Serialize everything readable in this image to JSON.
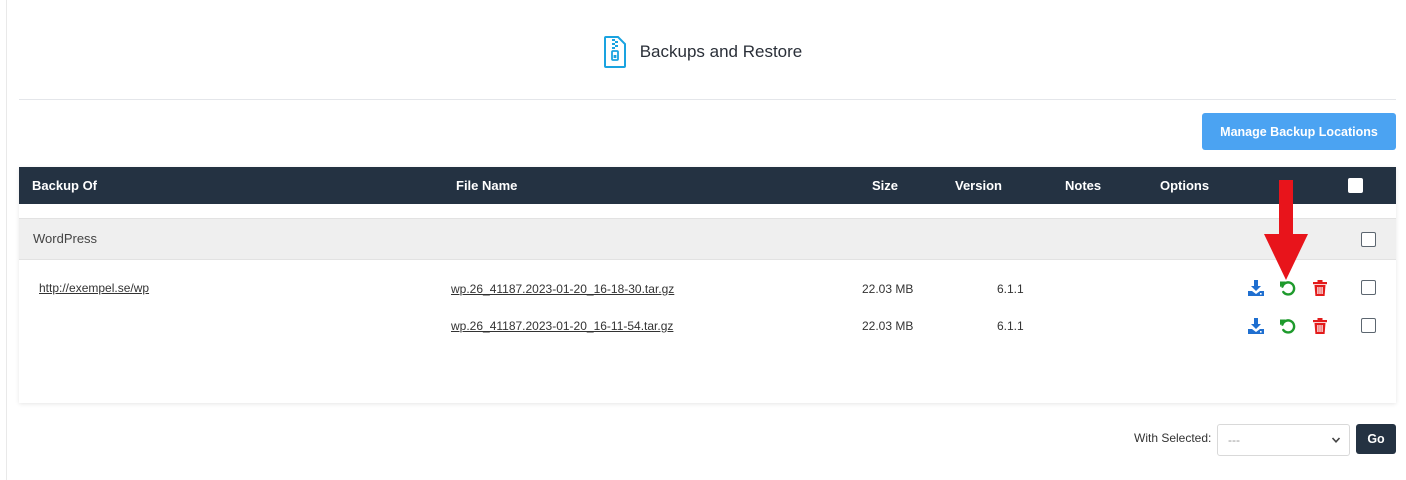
{
  "header": {
    "title": "Backups and Restore",
    "icon": "zip-file-icon"
  },
  "toolbar": {
    "manage_label": "Manage Backup Locations"
  },
  "table": {
    "columns": [
      "Backup Of",
      "File Name",
      "Size",
      "Version",
      "Notes",
      "Options"
    ],
    "group": "WordPress",
    "site_url": "http://exempel.se/wp",
    "rows": [
      {
        "file_name": "wp.26_41187.2023-01-20_16-18-30.tar.gz",
        "size": "22.03 MB",
        "version": "6.1.1",
        "notes": ""
      },
      {
        "file_name": "wp.26_41187.2023-01-20_16-11-54.tar.gz",
        "size": "22.03 MB",
        "version": "6.1.1",
        "notes": ""
      }
    ],
    "row_icons": [
      "download-icon",
      "restore-icon",
      "trash-icon"
    ]
  },
  "footer": {
    "with_selected_label": "With Selected:",
    "select_value": "---",
    "go_label": "Go"
  },
  "colors": {
    "header_bg": "#243242",
    "primary_button": "#4ba3f2",
    "download": "#1f6fd0",
    "restore": "#1e9a2c",
    "delete": "#e31b1b",
    "annotation_arrow": "#e8141b"
  }
}
